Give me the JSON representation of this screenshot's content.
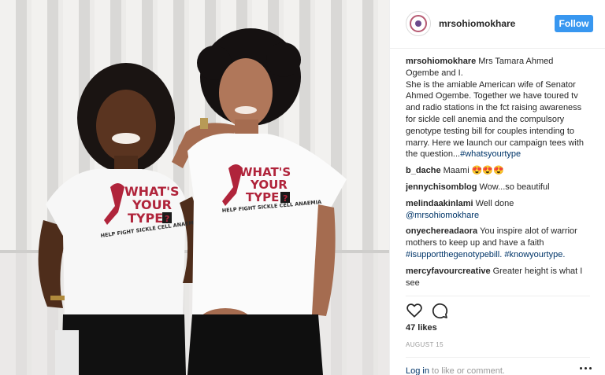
{
  "post": {
    "username": "mrsohiomokhare",
    "follow_label": "Follow",
    "caption": {
      "user": "mrsohiomokhare",
      "lines": [
        "Mrs Tamara Ahmed",
        "Ogembe and I.",
        "She is the amiable American wife of Senator",
        "Ahmed Ogembe. Together we have toured tv",
        "and radio stations in the fct raising awareness",
        "for sickle cell anemia and the compulsory",
        "genotype testing bill for couples intending to",
        "marry. Here we launch our campaign tees with",
        "the question..."
      ],
      "hashtag": "#whatsyourtype"
    },
    "comments": [
      {
        "user": "b_dache",
        "text": "Maami 😍😍😍"
      },
      {
        "user": "jennychisomblog",
        "text": "Wow...so beautiful"
      },
      {
        "user": "melindaakinlami",
        "text": "Well done",
        "mention": "@mrsohiomokhare"
      },
      {
        "user": "onyechereadaora",
        "text_lines": [
          "You inspire alot of warrior",
          "mothers to keep up and have a faith"
        ],
        "tags": "#isupportthegenotypebill. #knowyourtype."
      },
      {
        "user": "mercyfavourcreative",
        "text": "Greater height is what I",
        "text2": "see"
      }
    ],
    "likes": "47 likes",
    "date": "AUGUST 15",
    "footer": {
      "login": "Log in",
      "rest": " to like or comment."
    }
  },
  "photo": {
    "tee_line1": "WHAT'S",
    "tee_line2": "YOUR",
    "tee_line3": "TYPE",
    "tee_badge": "?",
    "tee_sub": "HELP FIGHT SICKLE CELL ANAEMIA"
  },
  "icons": {
    "like": "heart-icon",
    "comment": "speech-bubble-icon",
    "more": "more-options-icon"
  },
  "colors": {
    "accent": "#3897f0",
    "link": "#003569",
    "muted": "#999999",
    "ribbon": "#b0243b"
  }
}
